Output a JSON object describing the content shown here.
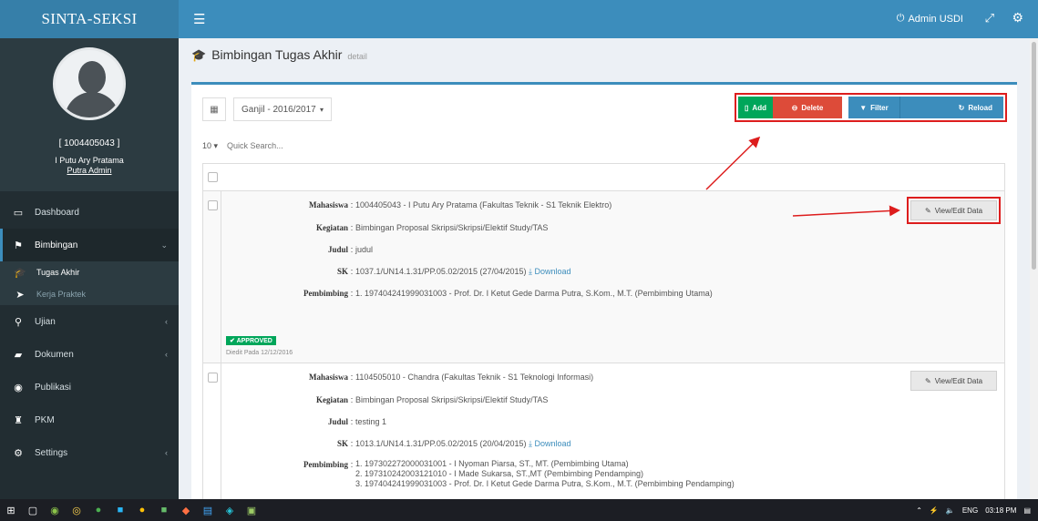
{
  "sidebar": {
    "brand": "SINTA-SEKSI",
    "user_id": "[ 1004405043 ]",
    "user_name": "I Putu Ary Pratama",
    "user_name_sub": "Putra Admin",
    "menu": [
      {
        "label": "Dashboard",
        "icon": "monitor-icon"
      },
      {
        "label": "Bimbingan",
        "icon": "flag-icon",
        "active": true
      },
      {
        "label": "Tugas Akhir",
        "icon": "graduation-cap-icon",
        "sub": true,
        "on": true
      },
      {
        "label": "Kerja Praktek",
        "icon": "paper-plane-icon",
        "sub": true
      },
      {
        "label": "Ujian",
        "icon": "pin-icon"
      },
      {
        "label": "Dokumen",
        "icon": "folder-icon"
      },
      {
        "label": "Publikasi",
        "icon": "globe-icon"
      },
      {
        "label": "PKM",
        "icon": "trophy-icon"
      },
      {
        "label": "Settings",
        "icon": "cogs-icon"
      }
    ]
  },
  "topbar": {
    "admin_label": "Admin USDI"
  },
  "header": {
    "title": "Bimbingan Tugas Akhir",
    "subtitle": "detail"
  },
  "toolbar": {
    "semester": "Ganjil - 2016/2017",
    "length": "10",
    "search_placeholder": "Quick Search...",
    "add": "Add",
    "delete": "Delete",
    "filter": "Filter",
    "reload": "Reload"
  },
  "labels": {
    "mahasiswa": "Mahasiswa",
    "kegiatan": "Kegiatan",
    "judul": "Judul",
    "sk": "SK",
    "pembimbing": "Pembimbing",
    "colon": ":",
    "download": "Download",
    "view_edit": "View/Edit Data"
  },
  "records": [
    {
      "mahasiswa": "1004405043 - I Putu Ary Pratama (Fakultas Teknik - S1 Teknik Elektro)",
      "kegiatan": "Bimbingan Proposal Skripsi/Skripsi/Elektif Study/TAS",
      "judul": "judul",
      "sk": "1037.1/UN14.1.31/PP.05.02/2015 (27/04/2015)",
      "pembimbing": [
        "1. 197404241999031003 - Prof. Dr. I Ketut Gede Darma Putra, S.Kom., M.T. (Pembimbing Utama)"
      ],
      "status": "APPROVED",
      "status_note": "Diedit Pada 12/12/2016"
    },
    {
      "mahasiswa": "1104505010 - Chandra (Fakultas Teknik - S1 Teknologi Informasi)",
      "kegiatan": "Bimbingan Proposal Skripsi/Skripsi/Elektif Study/TAS",
      "judul": "testing 1",
      "sk": "1013.1/UN14.1.31/PP.05.02/2015 (20/04/2015)",
      "pembimbing": [
        "1. 197302272000031001 - I Nyoman Piarsa, ST., MT. (Pembimbing Utama)",
        "2. 197310242003121010 - I Made Sukarsa, ST.,MT (Pembimbing Pendamping)",
        "3. 197404241999031003 - Prof. Dr. I Ketut Gede Darma Putra, S.Kom., M.T. (Pembimbing Pendamping)"
      ]
    }
  ],
  "taskbar": {
    "lang": "ENG",
    "time": "03:18 PM"
  },
  "colors": {
    "primary": "#3c8dbc",
    "success": "#00a65a",
    "danger": "#dd4b39",
    "sidebar": "#222d32",
    "highlight": "#dd1d1d"
  }
}
